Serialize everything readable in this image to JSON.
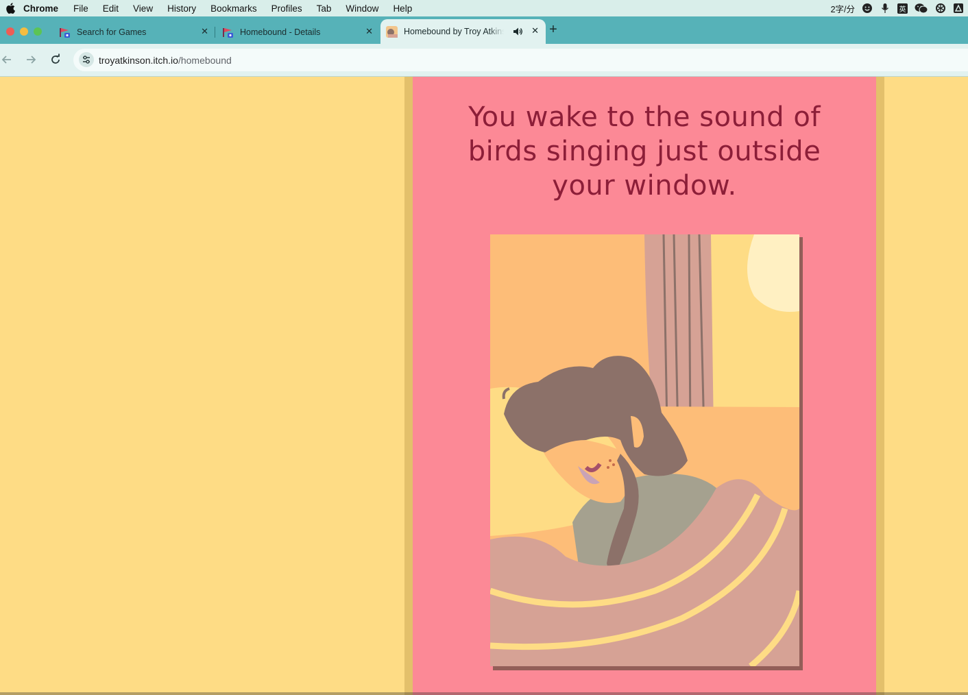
{
  "menubar": {
    "app": "Chrome",
    "items": [
      "File",
      "Edit",
      "View",
      "History",
      "Bookmarks",
      "Profiles",
      "Tab",
      "Window",
      "Help"
    ],
    "ime_status": "2字/分",
    "icons": [
      "apple-icon",
      "emoji-icon",
      "microphone-icon",
      "input-method-icon",
      "wechat-icon",
      "openai-icon",
      "drive-icon"
    ],
    "input_method_label": "英"
  },
  "tabs": [
    {
      "title": "Search for Games",
      "icon": "itch-favicon-icon",
      "active": false
    },
    {
      "title": "Homebound - Details",
      "icon": "itch-favicon-icon",
      "active": false
    },
    {
      "title": "Homebound by Troy Atkinson",
      "icon": "homebound-favicon-icon",
      "active": true,
      "audio": true
    }
  ],
  "new_tab_label": "+",
  "close_glyph": "✕",
  "address": {
    "domain": "troyatkinson.itch.io",
    "path": "/homebound"
  },
  "page": {
    "story_lines": [
      "You wake to the sound of",
      "birds singing just outside",
      "your window."
    ],
    "illustration": "girl sleeping in bed under striped blanket by window with curtain",
    "colors": {
      "background": "#fedc85",
      "column": "#fc8996",
      "text": "#8c1e38",
      "chrome_tabstrip": "#56b2b8",
      "chrome_toolbar": "#e2f2f0"
    }
  }
}
